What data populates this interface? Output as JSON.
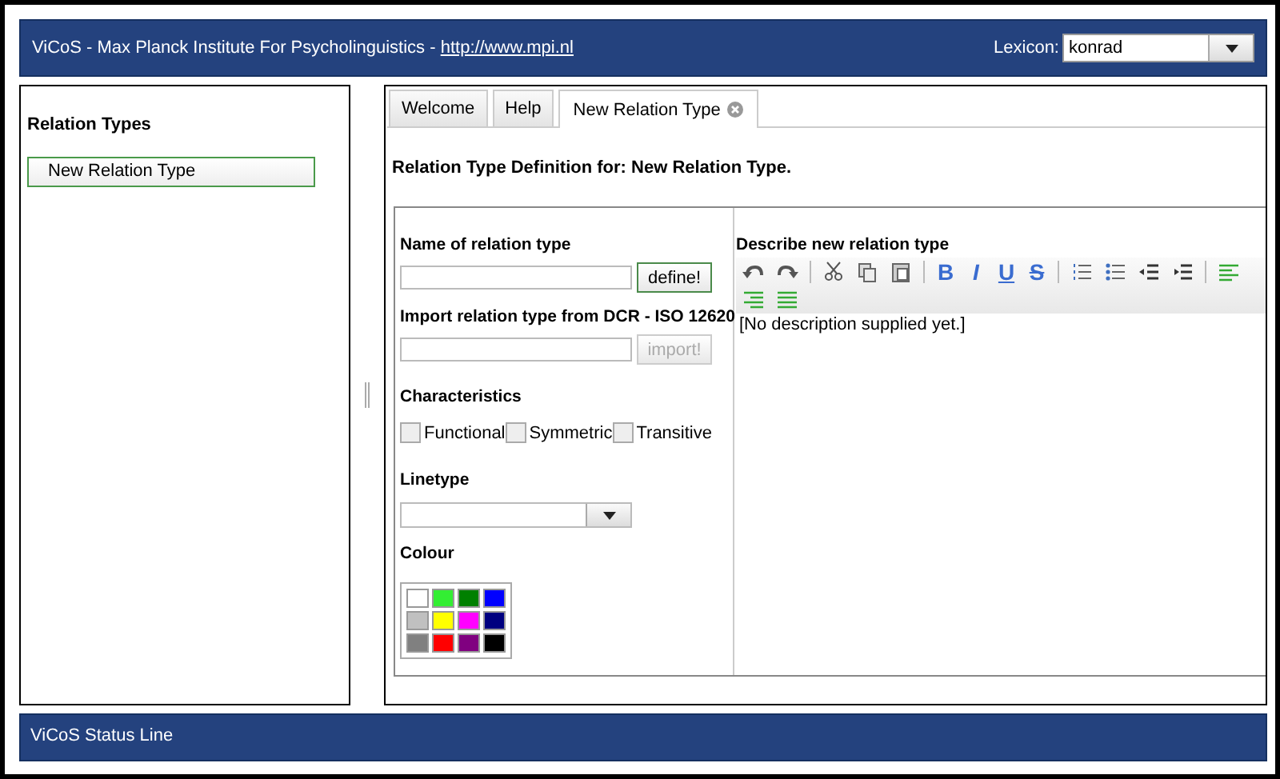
{
  "header": {
    "title": "ViCoS - Max Planck Institute For Psycholinguistics - ",
    "link": "http://www.mpi.nl",
    "lexicon_label": "Lexicon:",
    "lexicon_value": "konrad"
  },
  "sidebar": {
    "title": "Relation Types",
    "items": [
      {
        "label": "New Relation Type",
        "selected": true
      }
    ]
  },
  "tabs": [
    {
      "label": "Welcome",
      "selected": false,
      "closable": false
    },
    {
      "label": "Help",
      "selected": false,
      "closable": false
    },
    {
      "label": "New Relation Type",
      "selected": true,
      "closable": true
    }
  ],
  "form": {
    "heading": "Relation Type Definition for: New Relation Type.",
    "name_label": "Name of relation type",
    "define_button": {
      "label": "define!",
      "disabled": false
    },
    "import_label": "Import relation type from DCR - ISO 12620",
    "import_button": {
      "label": "import!",
      "disabled": true
    },
    "characteristics_label": "Characteristics",
    "characteristics": [
      {
        "label": "Functional",
        "checked": false
      },
      {
        "label": "Symmetric",
        "checked": false
      },
      {
        "label": "Transitive",
        "checked": false
      }
    ],
    "linetype_label": "Linetype",
    "colour_label": "Colour",
    "colours": [
      {
        "color": "#ffffff"
      },
      {
        "color": "#33ee33"
      },
      {
        "color": "#008000"
      },
      {
        "color": "#0000ff"
      },
      {
        "color": "#c0c0c0"
      },
      {
        "color": "#ffff00"
      },
      {
        "color": "#ff00ff"
      },
      {
        "color": "#000080"
      },
      {
        "color": "#808080"
      },
      {
        "color": "#ff0000"
      },
      {
        "color": "#800080"
      },
      {
        "color": "#000000"
      }
    ]
  },
  "editor": {
    "label": "Describe new relation type",
    "format_buttons": [
      "B",
      "I",
      "U",
      "S"
    ],
    "content": "[No description supplied yet.]"
  },
  "status_bar": "ViCoS Status Line"
}
